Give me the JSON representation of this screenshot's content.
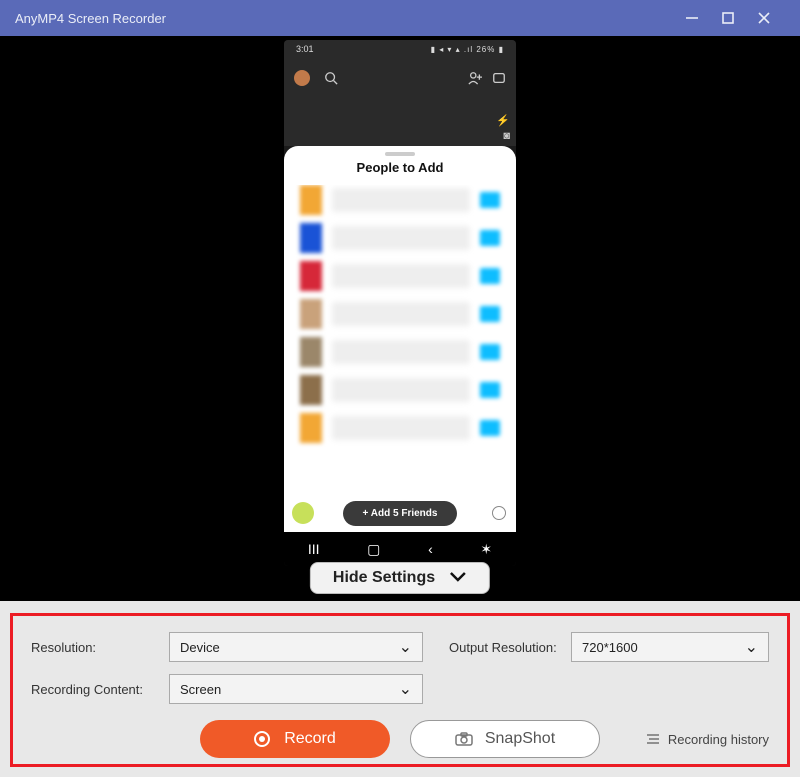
{
  "window": {
    "title": "AnyMP4 Screen Recorder"
  },
  "phone": {
    "clock": "3:01",
    "battery": "26%",
    "sheet_title": "People to Add",
    "add_friends": "+ Add 5 Friends"
  },
  "toggle": {
    "hide_settings": "Hide Settings"
  },
  "settings": {
    "resolution_label": "Resolution:",
    "resolution_value": "Device",
    "content_label": "Recording Content:",
    "content_value": "Screen",
    "output_res_label": "Output Resolution:",
    "output_res_value": "720*1600"
  },
  "actions": {
    "record": "Record",
    "snapshot": "SnapShot",
    "history": "Recording history"
  }
}
